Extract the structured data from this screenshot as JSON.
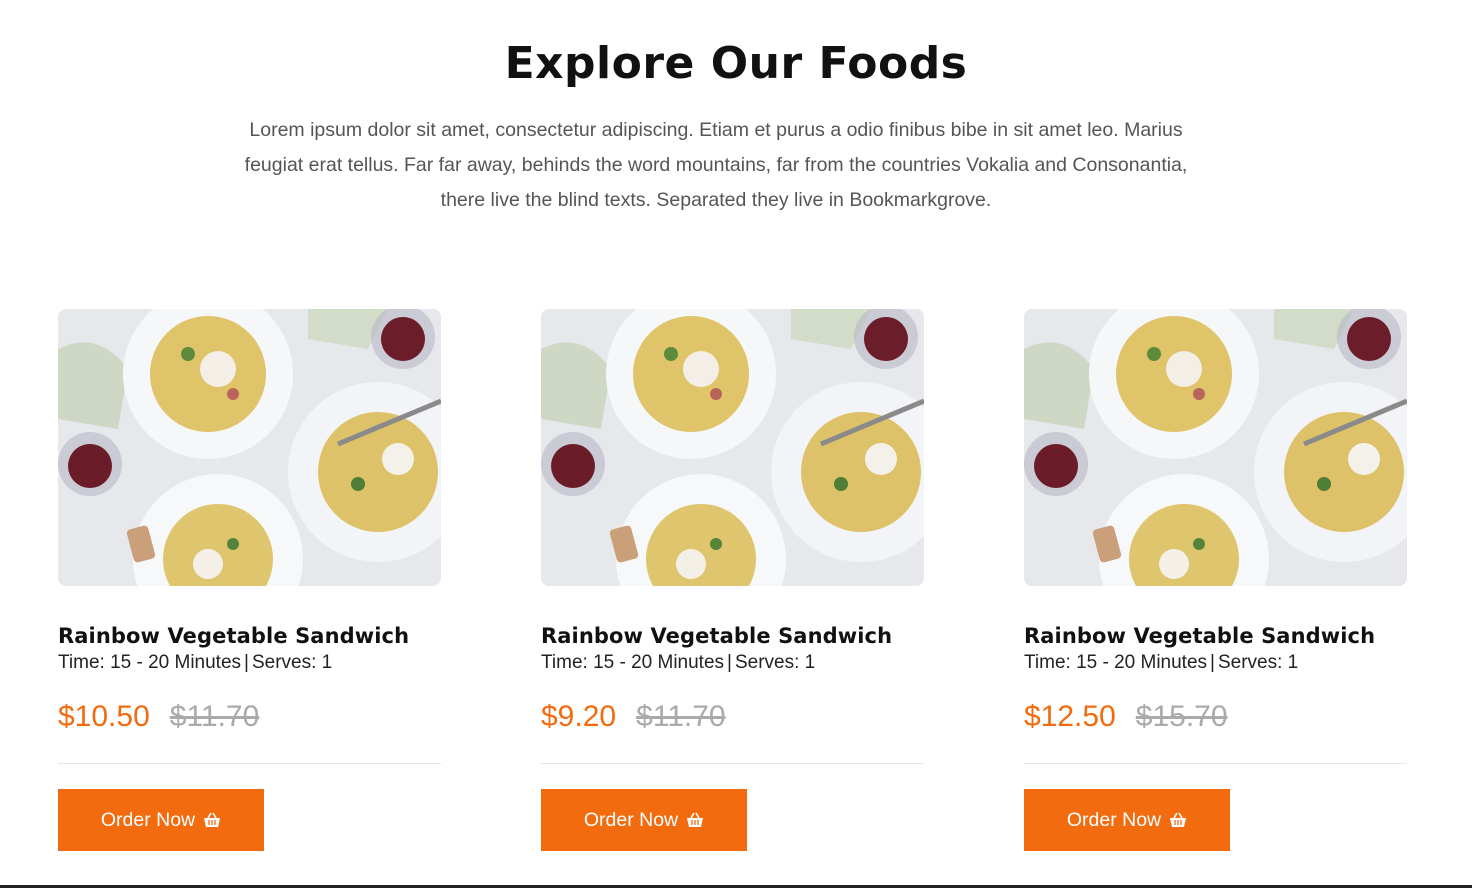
{
  "section": {
    "title": "Explore Our Foods",
    "description": "Lorem ipsum dolor sit amet, consectetur adipiscing. Etiam et purus a odio finibus bibe in sit amet leo. Marius feugiat erat tellus. Far far away, behinds the word mountains, far from the countries Vokalia and Consonantia, there live the blind texts. Separated they live in Bookmarkgrove."
  },
  "cards": [
    {
      "title": "Rainbow Vegetable Sandwich",
      "time": "Time: 15 - 20 Minutes",
      "serves": "Serves: 1",
      "price": "$10.50",
      "old_price": "$11.70",
      "button_label": "Order Now"
    },
    {
      "title": "Rainbow Vegetable Sandwich",
      "time": "Time: 15 - 20 Minutes",
      "serves": "Serves: 1",
      "price": "$9.20",
      "old_price": "$11.70",
      "button_label": "Order Now"
    },
    {
      "title": "Rainbow Vegetable Sandwich",
      "time": "Time: 15 - 20 Minutes",
      "serves": "Serves: 1",
      "price": "$12.50",
      "old_price": "$15.70",
      "button_label": "Order Now"
    }
  ],
  "colors": {
    "accent": "#f26b0f",
    "old_price": "#aaaaaa"
  },
  "icons": {
    "button_icon": "basket-icon",
    "image_subject": "pasta-dishes-with-wine"
  }
}
